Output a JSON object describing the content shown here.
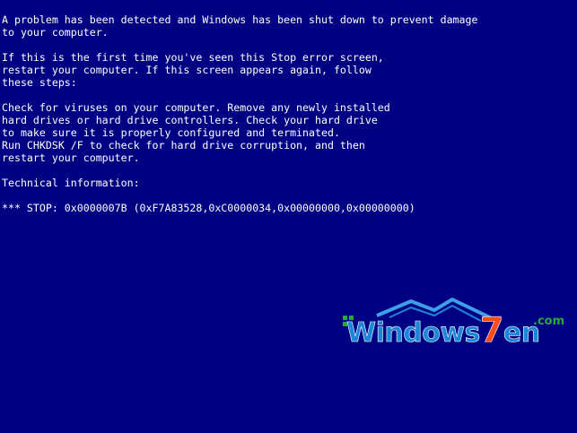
{
  "screen": {
    "background_color": "#000082",
    "text_color": "#ffffff",
    "lines": [
      "A problem has been detected and Windows has been shut down to prevent damage",
      "to your computer.",
      "If this is the first time you've seen this Stop error screen,",
      "restart your computer. If this screen appears again, follow",
      "these steps:",
      "Check for viruses on your computer. Remove any newly installed",
      "hard drives or hard drive controllers. Check your hard drive",
      "to make sure it is properly configured and terminated.",
      "Run CHKDSK /F to check for hard drive corruption, and then",
      "restart your computer.",
      "Technical information:",
      "*** STOP: 0x0000007B (0xF7A83528,0xC0000034,0x00000000,0x00000000)"
    ]
  },
  "watermark": {
    "text": "Windows7en",
    "suffix": ".com",
    "colors": {
      "word": "#1c86d8",
      "digit": "#ff4a1a",
      "suffix": "#2aa83a",
      "roof": "#3da0e6"
    }
  }
}
